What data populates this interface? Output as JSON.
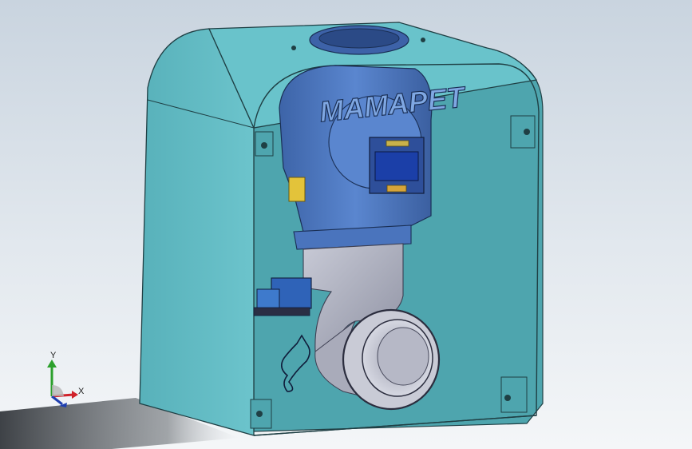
{
  "viewport": {
    "background_top": "#c9d4df",
    "background_bottom": "#f4f6f8"
  },
  "model": {
    "embossed_text": "MAMAPET",
    "enclosure_color": "#5fb9c1",
    "pump_color": "#4f78bf",
    "pipe_color": "#b6b8c6",
    "display_color": "#1b3fa8",
    "terminal_block_color": "#2f63b8"
  },
  "triad": {
    "x_label": "X",
    "y_label": "Y",
    "x_color": "#d0212a",
    "y_color": "#2ca02c",
    "z_color": "#1f3fb0"
  }
}
